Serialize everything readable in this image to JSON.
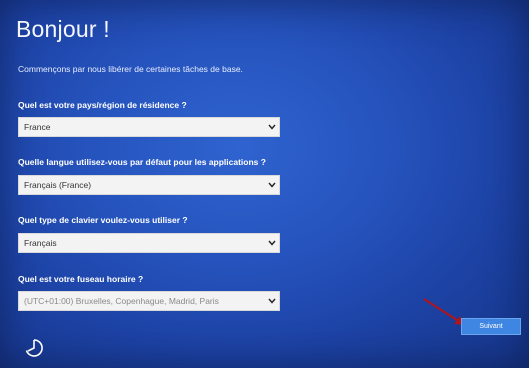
{
  "setup": {
    "title": "Bonjour !",
    "subtitle": "Commençons par nous libérer de certaines tâches de base.",
    "questions": [
      {
        "label": "Quel est votre pays/région de résidence ?",
        "value": "France"
      },
      {
        "label": "Quelle langue utilisez-vous par défaut pour les applications ?",
        "value": "Français (France)"
      },
      {
        "label": "Quel type de clavier voulez-vous utiliser ?",
        "value": "Français"
      },
      {
        "label": "Quel est votre fuseau horaire ?",
        "value": "(UTC+01:00) Bruxelles, Copenhague, Madrid, Paris"
      }
    ],
    "next_label": "Suivant"
  },
  "icons": {
    "dropdown": "chevron-down-icon",
    "accessibility": "ease-of-access-icon",
    "annotation": "red-arrow"
  },
  "colors": {
    "background": "#2654be",
    "button": "#3e86e2",
    "arrow": "#b0141c"
  }
}
